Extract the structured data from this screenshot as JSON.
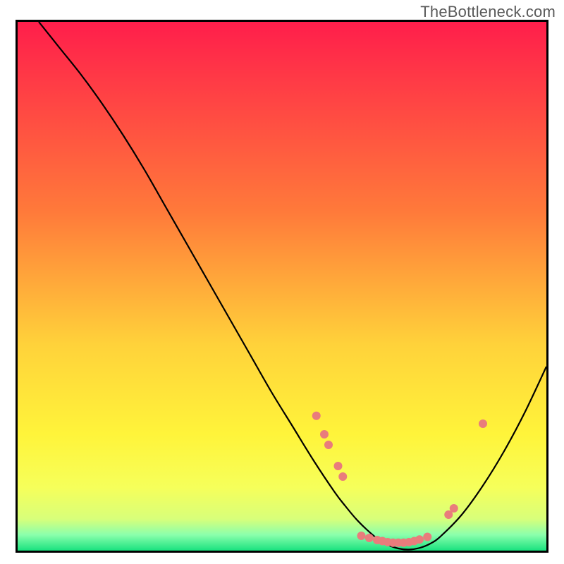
{
  "watermark": "TheBottleneck.com",
  "gradient_stops": [
    {
      "offset": "0%",
      "color": "#ff1e4b"
    },
    {
      "offset": "36%",
      "color": "#ff7a3a"
    },
    {
      "offset": "61%",
      "color": "#ffd23a"
    },
    {
      "offset": "78%",
      "color": "#fff43a"
    },
    {
      "offset": "88%",
      "color": "#f6ff5a"
    },
    {
      "offset": "94%",
      "color": "#d8ff7a"
    },
    {
      "offset": "97%",
      "color": "#8bffac"
    },
    {
      "offset": "100%",
      "color": "#19e27f"
    }
  ],
  "chart_data": {
    "type": "line",
    "title": "",
    "xlabel": "",
    "ylabel": "",
    "xlim": [
      0,
      100
    ],
    "ylim": [
      0,
      100
    ],
    "series": [
      {
        "name": "curve",
        "x": [
          4,
          8,
          12,
          16,
          20,
          24,
          28,
          32,
          36,
          40,
          44,
          48,
          52,
          56,
          60,
          62,
          64,
          66,
          68,
          70,
          72,
          74,
          76,
          78,
          80,
          84,
          88,
          92,
          96,
          100
        ],
        "y": [
          100,
          95,
          90,
          84.5,
          78.5,
          72,
          65,
          58,
          51,
          44,
          37,
          30,
          23.5,
          17,
          11,
          8.4,
          6,
          4,
          2.3,
          1.1,
          0.4,
          0.2,
          0.5,
          1.3,
          2.7,
          6.8,
          12.3,
          18.8,
          26.3,
          34.8
        ]
      }
    ],
    "markers": {
      "color": "#e97c7c",
      "radius": 6,
      "points": [
        {
          "x": 56.5,
          "y": 25.5
        },
        {
          "x": 58.0,
          "y": 22.0
        },
        {
          "x": 58.8,
          "y": 20.0
        },
        {
          "x": 60.6,
          "y": 16.0
        },
        {
          "x": 61.5,
          "y": 14.0
        },
        {
          "x": 65.0,
          "y": 2.8
        },
        {
          "x": 66.5,
          "y": 2.4
        },
        {
          "x": 68.0,
          "y": 2.0
        },
        {
          "x": 69.0,
          "y": 1.8
        },
        {
          "x": 70.0,
          "y": 1.6
        },
        {
          "x": 71.0,
          "y": 1.5
        },
        {
          "x": 72.0,
          "y": 1.5
        },
        {
          "x": 73.0,
          "y": 1.5
        },
        {
          "x": 74.0,
          "y": 1.6
        },
        {
          "x": 75.0,
          "y": 1.8
        },
        {
          "x": 76.0,
          "y": 2.1
        },
        {
          "x": 77.5,
          "y": 2.6
        },
        {
          "x": 81.5,
          "y": 6.8
        },
        {
          "x": 82.5,
          "y": 8.0
        },
        {
          "x": 88.0,
          "y": 24.0
        }
      ]
    }
  }
}
